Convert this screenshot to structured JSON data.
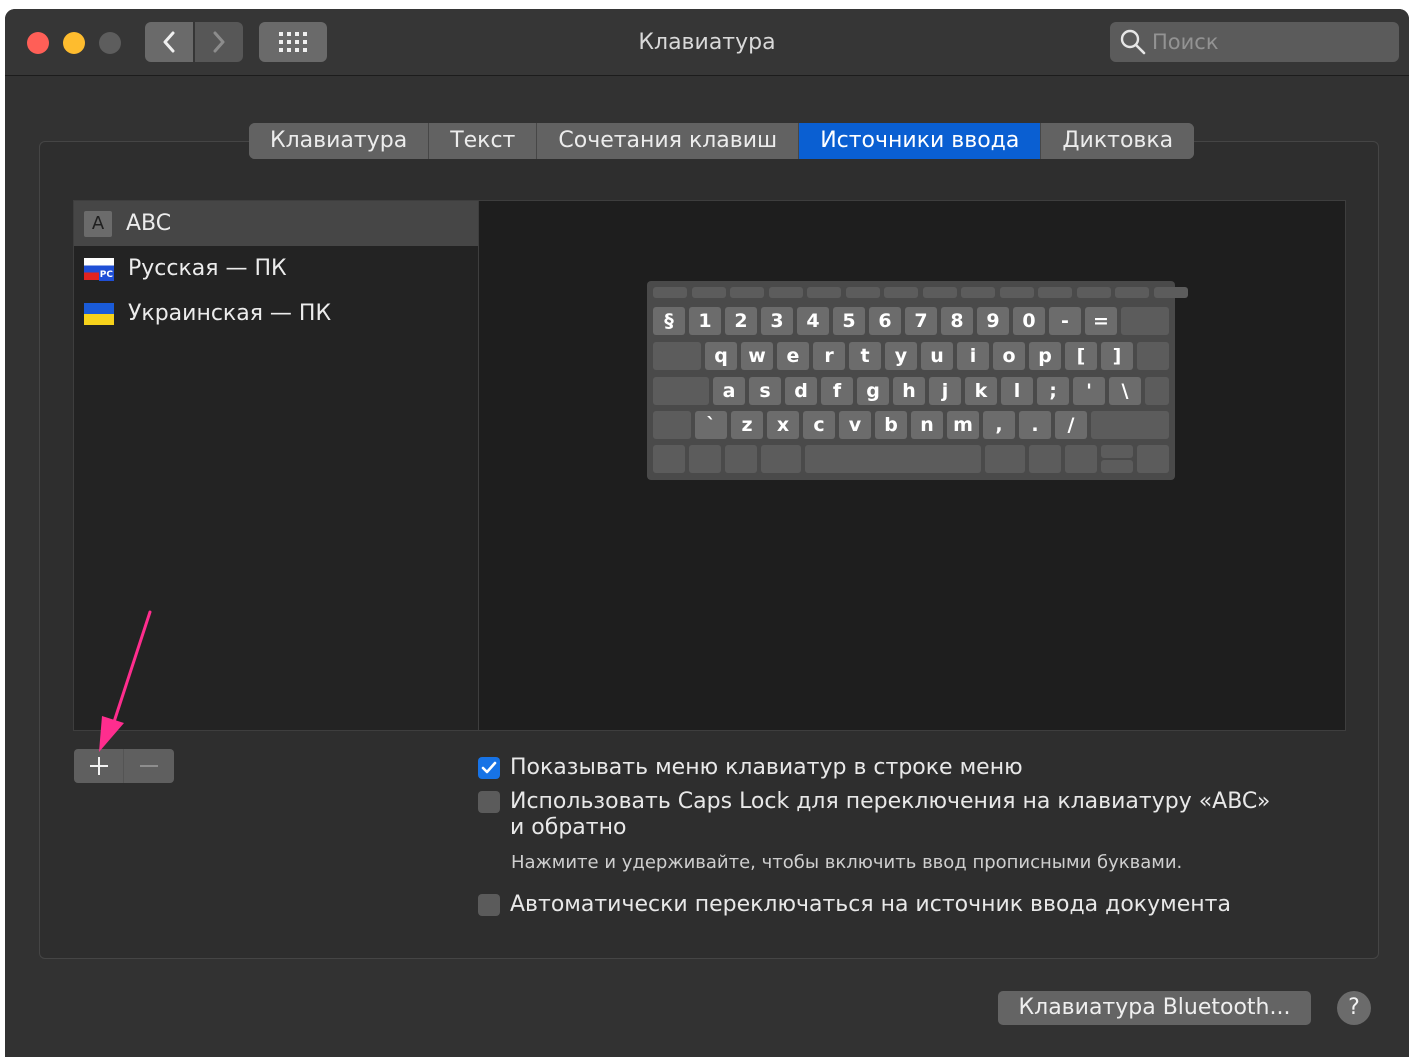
{
  "window": {
    "title": "Клавиатура",
    "search_placeholder": "Поиск"
  },
  "icons": {
    "back": "chevron-left-icon",
    "forward": "chevron-right-icon",
    "grid": "grid-icon",
    "search": "search-icon",
    "add": "plus-icon",
    "remove": "minus-icon",
    "check": "checkmark-icon",
    "help": "question-icon"
  },
  "tabs": [
    {
      "label": "Клавиатура",
      "active": false
    },
    {
      "label": "Текст",
      "active": false
    },
    {
      "label": "Сочетания клавиш",
      "active": false
    },
    {
      "label": "Источники ввода",
      "active": true
    },
    {
      "label": "Диктовка",
      "active": false
    }
  ],
  "sources": [
    {
      "icon_text": "A",
      "label": "ABC",
      "selected": true
    },
    {
      "label": "Русская — ПК",
      "badge": "PC",
      "selected": false
    },
    {
      "label": "Украинская — ПК",
      "selected": false
    }
  ],
  "keyboard": {
    "row1": [
      "§",
      "1",
      "2",
      "3",
      "4",
      "5",
      "6",
      "7",
      "8",
      "9",
      "0",
      "-",
      "="
    ],
    "row2": [
      "q",
      "w",
      "e",
      "r",
      "t",
      "y",
      "u",
      "i",
      "o",
      "p",
      "[",
      "]"
    ],
    "row3": [
      "a",
      "s",
      "d",
      "f",
      "g",
      "h",
      "j",
      "k",
      "l",
      ";",
      "'",
      "\\"
    ],
    "row4": [
      "`",
      "z",
      "x",
      "c",
      "v",
      "b",
      "n",
      "m",
      ",",
      ".",
      "/"
    ]
  },
  "options": {
    "show_menu": {
      "label": "Показывать меню клавиатур в строке меню",
      "checked": true
    },
    "caps_lock": {
      "label": "Использовать Caps Lock для переключения на клавиатуру «ABC»",
      "continuation": "и обратно",
      "hint": "Нажмите и удерживайте, чтобы включить ввод прописными буквами.",
      "checked": false
    },
    "auto_switch": {
      "label": "Автоматически переключаться на источник ввода документа",
      "checked": false
    }
  },
  "buttons": {
    "bluetooth": "Клавиатура Bluetooth...",
    "help": "?"
  },
  "colors": {
    "accent": "#0a5fd2",
    "annotation_arrow": "#ff2d8e"
  }
}
